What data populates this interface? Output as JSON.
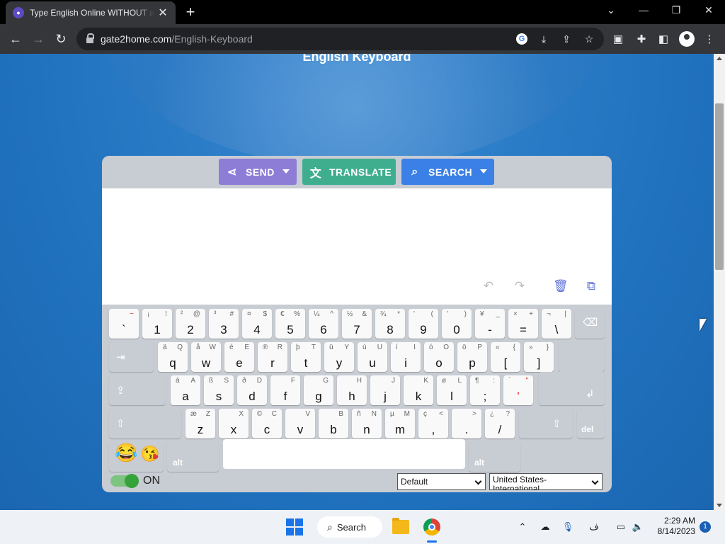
{
  "browser": {
    "tab_title": "Type English Online WITHOUT a Keyboard",
    "tab_favicon": "chat",
    "new_tab_label": "+",
    "url_host": "gate2home.com",
    "url_path": "/English-Keyboard"
  },
  "page": {
    "heading": "English Keyboard"
  },
  "actions": {
    "send": "SEND",
    "translate": "TRANSLATE",
    "search": "SEARCH"
  },
  "keyboard": {
    "rows": [
      [
        {
          "main": "`",
          "s1": "",
          "s2": "~",
          "s2_red": true
        },
        {
          "main": "1",
          "s1": "¡",
          "s2": "!"
        },
        {
          "main": "2",
          "s1": "²",
          "s2": "@"
        },
        {
          "main": "3",
          "s1": "³",
          "s2": "#"
        },
        {
          "main": "4",
          "s1": "¤",
          "s2": "$"
        },
        {
          "main": "5",
          "s1": "€",
          "s2": "%"
        },
        {
          "main": "6",
          "s1": "¼",
          "s2": "^"
        },
        {
          "main": "7",
          "s1": "½",
          "s2": "&"
        },
        {
          "main": "8",
          "s1": "¾",
          "s2": "*"
        },
        {
          "main": "9",
          "s1": "'",
          "s2": "("
        },
        {
          "main": "0",
          "s1": "'",
          "s2": ")"
        },
        {
          "main": "-",
          "s1": "¥",
          "s2": "_"
        },
        {
          "main": "=",
          "s1": "×",
          "s2": "+"
        },
        {
          "main": "\\",
          "s1": "¬",
          "s2": "|"
        }
      ],
      [
        {
          "main": "q",
          "s1": "ä",
          "s2": "Q"
        },
        {
          "main": "w",
          "s1": "å",
          "s2": "W"
        },
        {
          "main": "e",
          "s1": "é",
          "s2": "E"
        },
        {
          "main": "r",
          "s1": "®",
          "s2": "R"
        },
        {
          "main": "t",
          "s1": "þ",
          "s2": "T"
        },
        {
          "main": "y",
          "s1": "ü",
          "s2": "Y"
        },
        {
          "main": "u",
          "s1": "ú",
          "s2": "U"
        },
        {
          "main": "i",
          "s1": "í",
          "s2": "I"
        },
        {
          "main": "o",
          "s1": "ó",
          "s2": "O"
        },
        {
          "main": "p",
          "s1": "ö",
          "s2": "P"
        },
        {
          "main": "[",
          "s1": "«",
          "s2": "{"
        },
        {
          "main": "]",
          "s1": "»",
          "s2": "}"
        }
      ],
      [
        {
          "main": "a",
          "s1": "á",
          "s2": "A"
        },
        {
          "main": "s",
          "s1": "ß",
          "s2": "S"
        },
        {
          "main": "d",
          "s1": "ð",
          "s2": "D"
        },
        {
          "main": "f",
          "s1": "",
          "s2": "F"
        },
        {
          "main": "g",
          "s1": "",
          "s2": "G"
        },
        {
          "main": "h",
          "s1": "",
          "s2": "H"
        },
        {
          "main": "j",
          "s1": "",
          "s2": "J"
        },
        {
          "main": "k",
          "s1": "",
          "s2": "K"
        },
        {
          "main": "l",
          "s1": "ø",
          "s2": "L"
        },
        {
          "main": ";",
          "s1": "¶",
          "s2": ":"
        },
        {
          "main": "'",
          "s1": "´",
          "s2": "\"",
          "main_red": true,
          "s2_red": true
        }
      ],
      [
        {
          "main": "z",
          "s1": "æ",
          "s2": "Z"
        },
        {
          "main": "x",
          "s1": "",
          "s2": "X"
        },
        {
          "main": "c",
          "s1": "©",
          "s2": "C"
        },
        {
          "main": "v",
          "s1": "",
          "s2": "V"
        },
        {
          "main": "b",
          "s1": "",
          "s2": "B"
        },
        {
          "main": "n",
          "s1": "ñ",
          "s2": "N"
        },
        {
          "main": "m",
          "s1": "µ",
          "s2": "M"
        },
        {
          "main": ",",
          "s1": "ç",
          "s2": "<"
        },
        {
          "main": ".",
          "s1": "",
          "s2": ">"
        },
        {
          "main": "/",
          "s1": "¿",
          "s2": "?"
        }
      ]
    ],
    "mod_labels": {
      "backspace": "⌫",
      "tab": "⇥",
      "caps": "⇪",
      "enter": "↲",
      "shift_left": "⇧",
      "shift_right": "⇧",
      "del": "del",
      "alt_left": "alt",
      "alt_right": "alt"
    },
    "emojis": [
      "😂",
      "😘"
    ]
  },
  "footer": {
    "toggle_label": "ON",
    "layout_select": "Default",
    "locale_select": "United States-International"
  },
  "taskbar": {
    "search_label": "Search",
    "time": "2:29 AM",
    "date": "8/14/2023",
    "notification_count": "1",
    "lang_indicator": "ف"
  }
}
